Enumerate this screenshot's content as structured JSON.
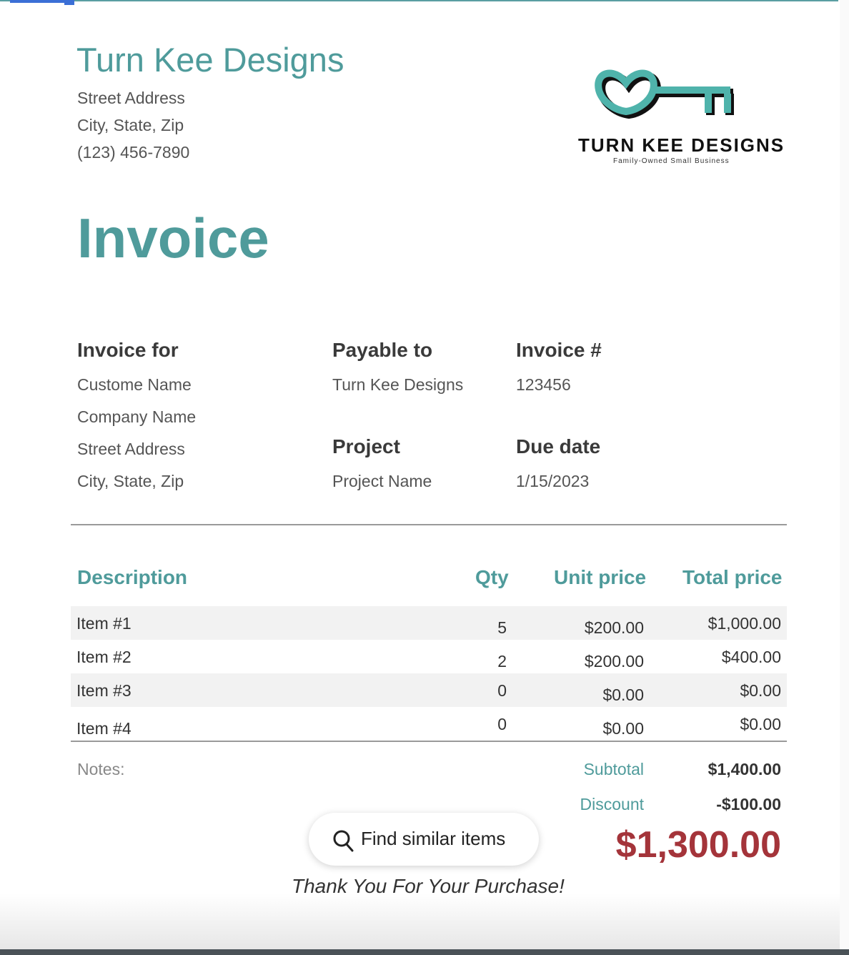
{
  "company": {
    "name": "Turn Kee Designs",
    "street": "Street Address",
    "city": "City, State, Zip",
    "phone": "(123) 456-7890"
  },
  "logo": {
    "title": "TURN KEE DESIGNS",
    "subtitle": "Family-Owned Small Business",
    "icon": "key-icon",
    "color": "#4fb3ab"
  },
  "title": "Invoice",
  "invoice_for": {
    "label": "Invoice for",
    "lines": [
      "Custome Name",
      "Company Name",
      "Street Address",
      "City, State, Zip"
    ]
  },
  "payable_to": {
    "label": "Payable to",
    "value": "Turn Kee Designs"
  },
  "invoice_number": {
    "label": "Invoice #",
    "value": "123456"
  },
  "project": {
    "label": "Project",
    "value": "Project Name"
  },
  "due_date": {
    "label": "Due date",
    "value": "1/15/2023"
  },
  "table": {
    "headers": {
      "description": "Description",
      "qty": "Qty",
      "unit_price": "Unit price",
      "total_price": "Total price"
    },
    "rows": [
      {
        "description": "Item #1",
        "qty": "5",
        "unit_price": "$200.00",
        "total_price": "$1,000.00"
      },
      {
        "description": "Item #2",
        "qty": "2",
        "unit_price": "$200.00",
        "total_price": "$400.00"
      },
      {
        "description": "Item #3",
        "qty": "0",
        "unit_price": "$0.00",
        "total_price": "$0.00"
      },
      {
        "description": "Item #4",
        "qty": "0",
        "unit_price": "$0.00",
        "total_price": "$0.00"
      }
    ]
  },
  "notes_label": "Notes:",
  "totals": {
    "subtotal_label": "Subtotal",
    "subtotal_value": "$1,400.00",
    "discount_label": "Discount",
    "discount_value": "-$100.00",
    "grand_total": "$1,300.00"
  },
  "find_similar": {
    "label": "Find similar items",
    "icon": "search-icon"
  },
  "thank_you": "Thank You For Your Purchase!",
  "colors": {
    "accent": "#4f9b9b",
    "total": "#a4343a"
  }
}
